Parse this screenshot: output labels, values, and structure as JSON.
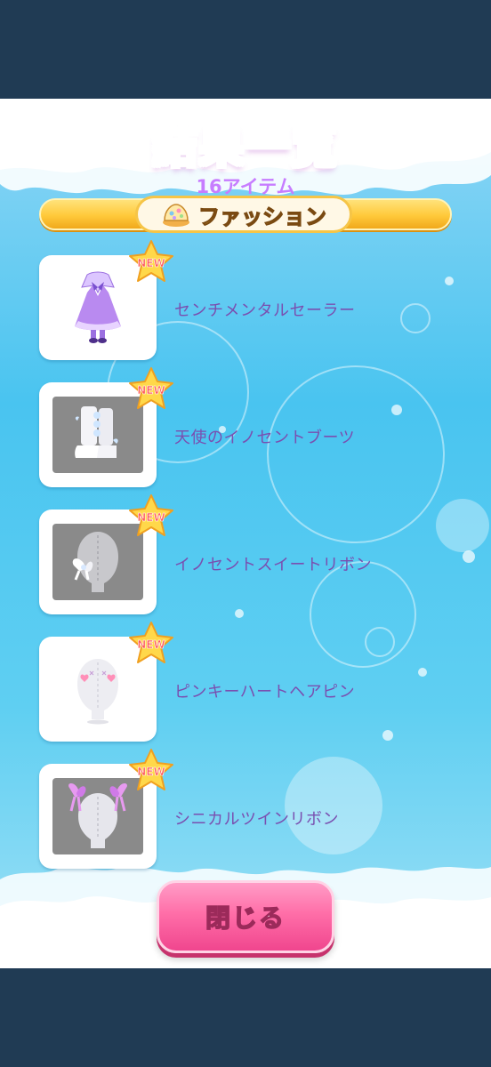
{
  "header": {
    "title": "結果一覧",
    "item_count": "16アイテム",
    "category": "ファッション"
  },
  "items": [
    {
      "name": "センチメンタルセーラー",
      "badge": "NEW",
      "thumb": "purple-sailor-dress"
    },
    {
      "name": "天使のイノセントブーツ",
      "badge": "NEW",
      "thumb": "white-boots"
    },
    {
      "name": "イノセントスイートリボン",
      "badge": "NEW",
      "thumb": "white-ribbon"
    },
    {
      "name": "ピンキーハートヘアピン",
      "badge": "NEW",
      "thumb": "heart-hairpin"
    },
    {
      "name": "シニカルツインリボン",
      "badge": "NEW",
      "thumb": "twin-ribbon"
    }
  ],
  "footer": {
    "close_label": "閉じる"
  },
  "colors": {
    "background": "#203b54",
    "panel_sky": "#49c4f0",
    "title_pink": "#ff6fa0",
    "count_purple": "#c77dff",
    "item_text": "#7a4fb0",
    "badge_yellow": "#ffd84a",
    "close_pink": "#ff6ea8"
  }
}
